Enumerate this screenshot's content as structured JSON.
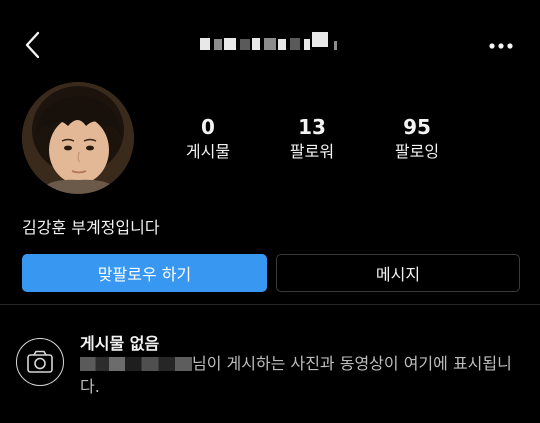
{
  "header": {
    "back_icon": "chevron-left-icon",
    "username": "",
    "more_icon": "more-horizontal-icon"
  },
  "profile": {
    "avatar_alt": "profile photo",
    "stats": [
      {
        "value": "0",
        "label": "게시물"
      },
      {
        "value": "13",
        "label": "팔로워"
      },
      {
        "value": "95",
        "label": "팔로잉"
      }
    ],
    "bio": "김강훈 부계정입니다"
  },
  "actions": {
    "follow_back_label": "맞팔로우 하기",
    "message_label": "메시지",
    "follow_color": "#3897f0"
  },
  "posts": {
    "camera_icon": "camera-icon",
    "empty_title": "게시물 없음",
    "empty_desc": "님이 게시하는 사진과 동영상이 여기에 표시됩니다."
  }
}
